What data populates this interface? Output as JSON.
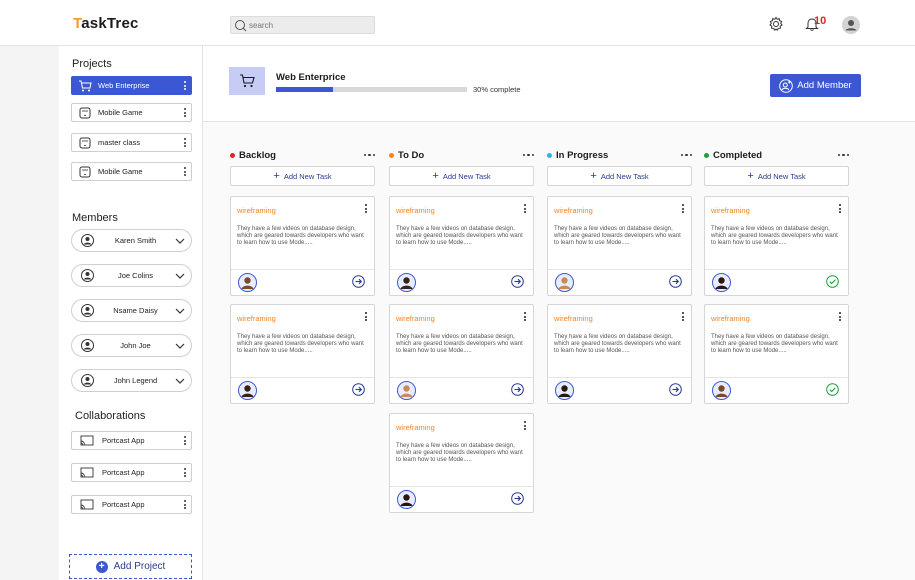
{
  "app": {
    "logo_first": "T",
    "logo_rest": "askTrec"
  },
  "header": {
    "search_placeholder": "search",
    "notification_count": "10"
  },
  "sidebar": {
    "projects_title": "Projects",
    "projects": [
      {
        "label": "Web Enterprise",
        "active": true
      },
      {
        "label": "Mobile Game",
        "active": false
      },
      {
        "label": "master class",
        "active": false
      },
      {
        "label": "Mobile Game",
        "active": false
      }
    ],
    "members_title": "Members",
    "members": [
      "Karen Smith",
      "Joe Colins",
      "Nsame Daisy",
      "John Joe",
      "John Legend"
    ],
    "collab_title": "Collaborations",
    "collaborations": [
      "Portcast App",
      "Portcast App",
      "Portcast App"
    ],
    "add_project_label": "Add Project"
  },
  "project": {
    "title": "Web Enterprice",
    "progress": 0.3,
    "progress_text": "30% complete",
    "add_member_label": "Add Member"
  },
  "board": {
    "add_task_label": "Add New Task",
    "card_tag": "wireframing",
    "card_desc": "They have a few videos on database design, which are geared towards developers who want to learn how to use Mode.....",
    "columns": [
      {
        "title": "Backlog",
        "color": "#e02424",
        "cards": 2,
        "done": false
      },
      {
        "title": "To Do",
        "color": "#f2831f",
        "cards": 3,
        "done": false
      },
      {
        "title": "In Progress",
        "color": "#2bb5e8",
        "cards": 2,
        "done": false
      },
      {
        "title": "Completed",
        "color": "#1f9e3a",
        "cards": 2,
        "done": true
      }
    ]
  },
  "colors": {
    "accent": "#3c57d4",
    "tag": "#f2831f"
  },
  "icons": [
    "search-icon",
    "gear-icon",
    "bell-icon",
    "user-avatar-icon",
    "cart-icon",
    "phone-icon",
    "cast-icon",
    "arrow-right-circle-icon",
    "check-circle-icon"
  ]
}
